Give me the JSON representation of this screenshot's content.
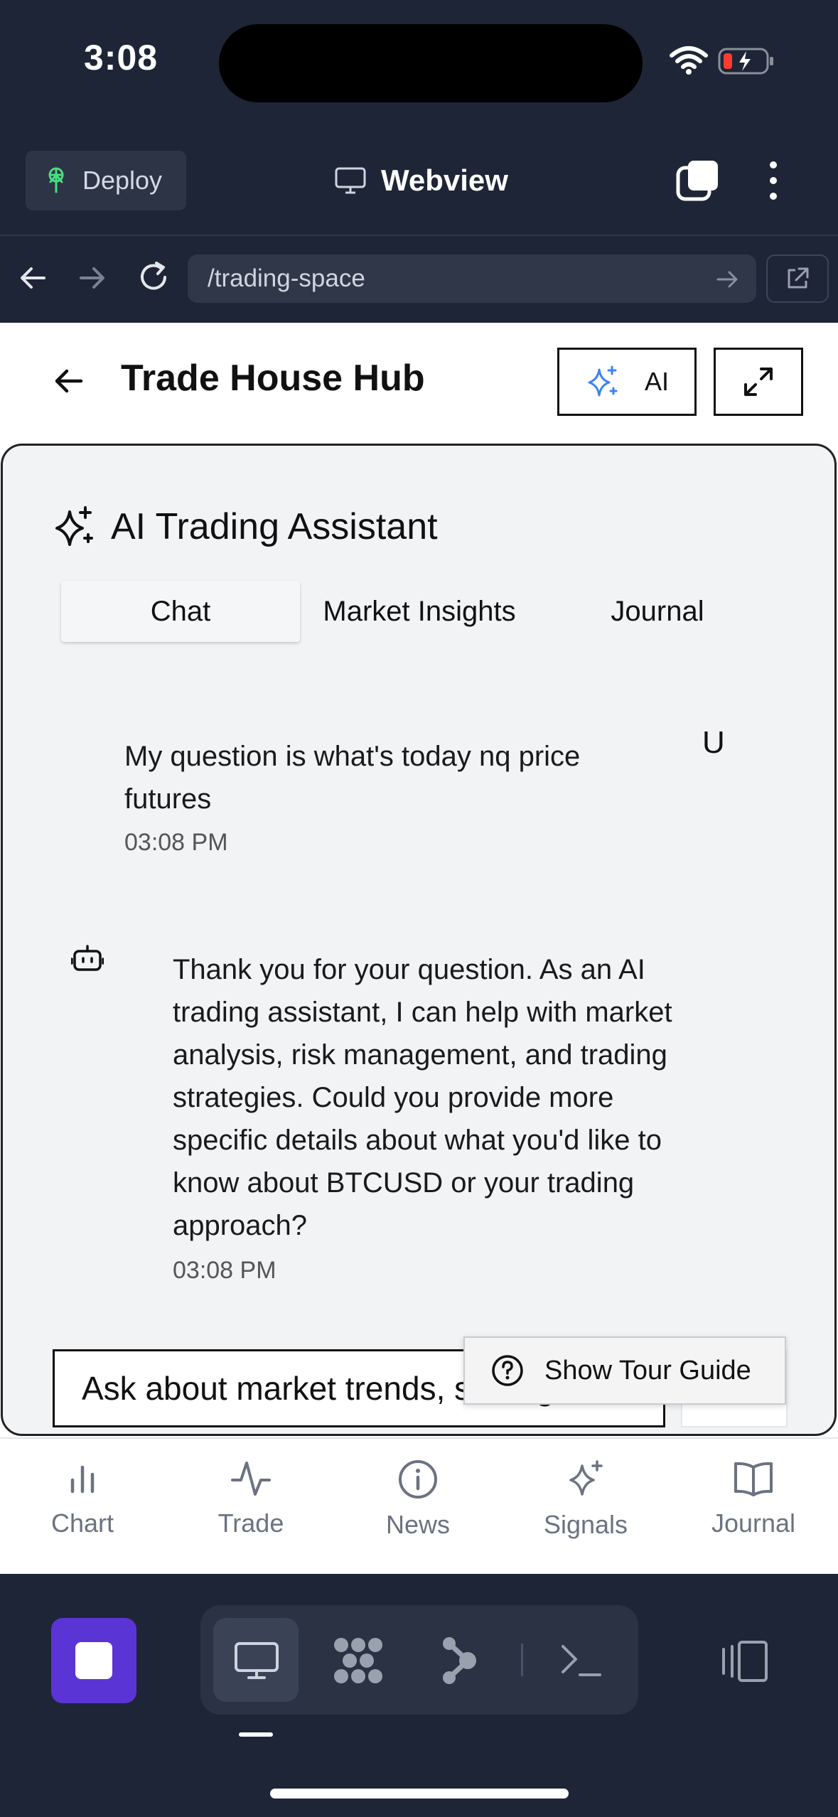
{
  "status_bar": {
    "time": "3:08"
  },
  "header": {
    "deploy_label": "Deploy",
    "webview_label": "Webview"
  },
  "browser": {
    "url": "/trading-space"
  },
  "app": {
    "title": "Trade House Hub",
    "ai_button_label": "AI"
  },
  "assistant": {
    "title": "AI Trading Assistant",
    "tabs": [
      {
        "label": "Chat",
        "active": true
      },
      {
        "label": "Market Insights",
        "active": false
      },
      {
        "label": "Journal",
        "active": false
      }
    ],
    "messages": [
      {
        "role": "user",
        "avatar": "U",
        "text": "My question is what's today nq price futures",
        "time": "03:08 PM"
      },
      {
        "role": "assistant",
        "icon": "bot-icon",
        "text": "Thank you for your question. As an AI trading assistant, I can help with market analysis, risk management, and trading strategies. Could you provide more specific details about what you'd like to know about BTCUSD or your trading approach?",
        "time": "03:08 PM"
      }
    ],
    "input_placeholder": "Ask about market trends, strategies,",
    "tour_guide_label": "Show Tour Guide"
  },
  "bottom_nav": {
    "items": [
      {
        "label": "Chart",
        "icon": "bar-chart-icon"
      },
      {
        "label": "Trade",
        "icon": "activity-icon"
      },
      {
        "label": "News",
        "icon": "info-icon"
      },
      {
        "label": "Signals",
        "icon": "sparkles-icon"
      },
      {
        "label": "Journal",
        "icon": "book-icon"
      }
    ]
  },
  "colors": {
    "chrome_bg": "#1e2536",
    "stop_button": "#5b34d6",
    "ai_sparkle": "#3b82f6",
    "nav_inactive": "#6b7280"
  }
}
